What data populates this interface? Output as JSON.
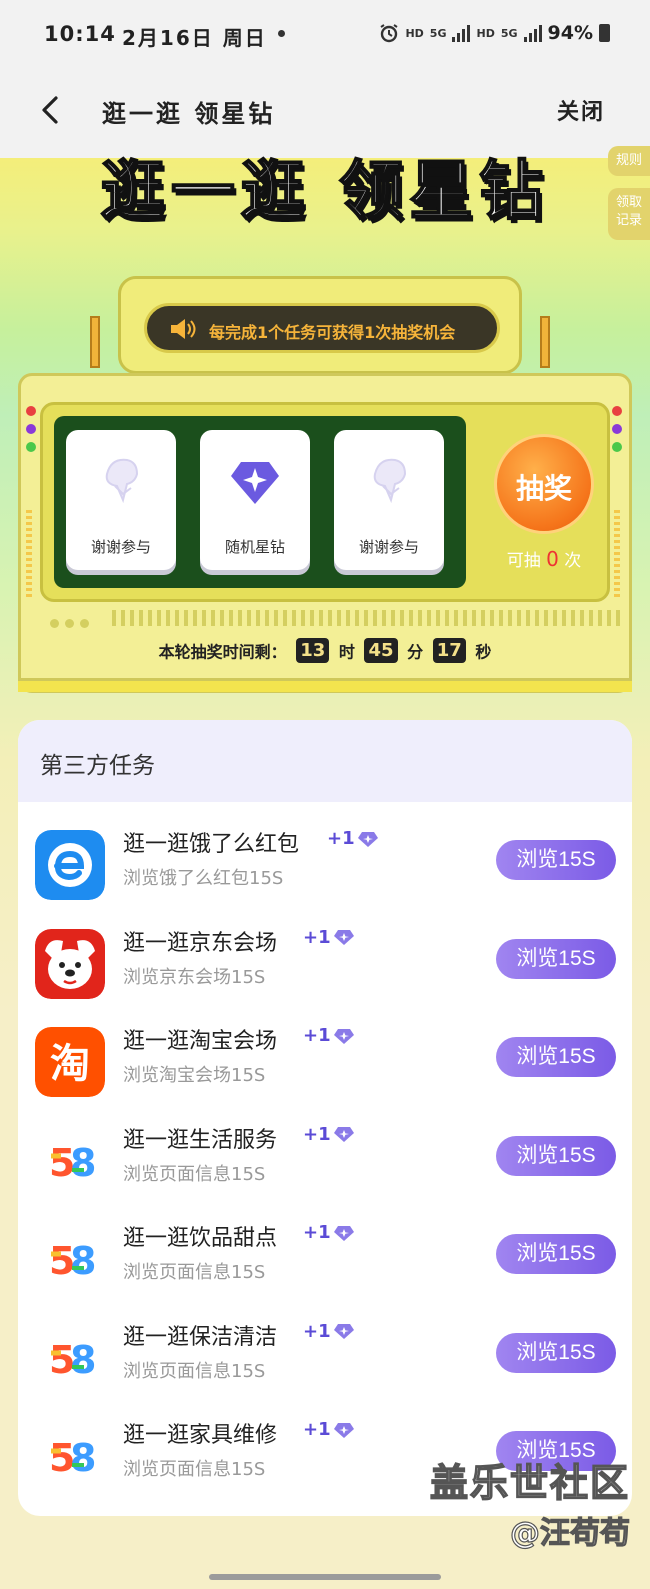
{
  "status_bar": {
    "time": "10:14",
    "date": "2月16日 周日",
    "hd1": "HD",
    "net1": "5G",
    "hd2": "HD",
    "net2": "5G",
    "battery": "94%"
  },
  "titlebar": {
    "title": "逛一逛 领星钻",
    "close_label": "关闭"
  },
  "hero": {
    "heading": "逛一逛 领星钻",
    "side_rules": "规则",
    "side_records": "领取记录",
    "banner_text": "每完成1个任务可获得1次抽奖机会",
    "prizes": [
      "谢谢参与",
      "随机星钻",
      "谢谢参与"
    ],
    "draw_label": "抽奖",
    "draw_prefix": "可抽",
    "draw_count": "0",
    "draw_suffix": "次",
    "timer_label": "本轮抽奖时间剩：",
    "timer_hours": "13",
    "timer_h_unit": "时",
    "timer_minutes": "45",
    "timer_m_unit": "分",
    "timer_seconds": "17",
    "timer_s_unit": "秒"
  },
  "tasks": {
    "header": "第三方任务",
    "items": [
      {
        "title": "逛一逛饿了么红包",
        "reward": "+1",
        "subtitle": "浏览饿了么红包15S",
        "button": "浏览15S",
        "logo": "eleme-logo"
      },
      {
        "title": "逛一逛京东会场",
        "reward": "+1",
        "subtitle": "浏览京东会场15S",
        "button": "浏览15S",
        "logo": "jd-logo"
      },
      {
        "title": "逛一逛淘宝会场",
        "reward": "+1",
        "subtitle": "浏览淘宝会场15S",
        "button": "浏览15S",
        "logo": "taobao-logo"
      },
      {
        "title": "逛一逛生活服务",
        "reward": "+1",
        "subtitle": "浏览页面信息15S",
        "button": "浏览15S",
        "logo": "58-logo"
      },
      {
        "title": "逛一逛饮品甜点",
        "reward": "+1",
        "subtitle": "浏览页面信息15S",
        "button": "浏览15S",
        "logo": "58-logo"
      },
      {
        "title": "逛一逛保洁清洁",
        "reward": "+1",
        "subtitle": "浏览页面信息15S",
        "button": "浏览15S",
        "logo": "58-logo"
      },
      {
        "title": "逛一逛家具维修",
        "reward": "+1",
        "subtitle": "浏览页面信息15S",
        "button": "浏览15S",
        "logo": "58-logo"
      }
    ]
  },
  "watermark": {
    "line1": "盖乐世社区",
    "line2": "@汪苟苟"
  },
  "colors": {
    "accent_purple": "#7b5be6",
    "timer_bg": "#222222",
    "draw_orange": "#f5741a",
    "screen_green": "#1b4f1c"
  }
}
